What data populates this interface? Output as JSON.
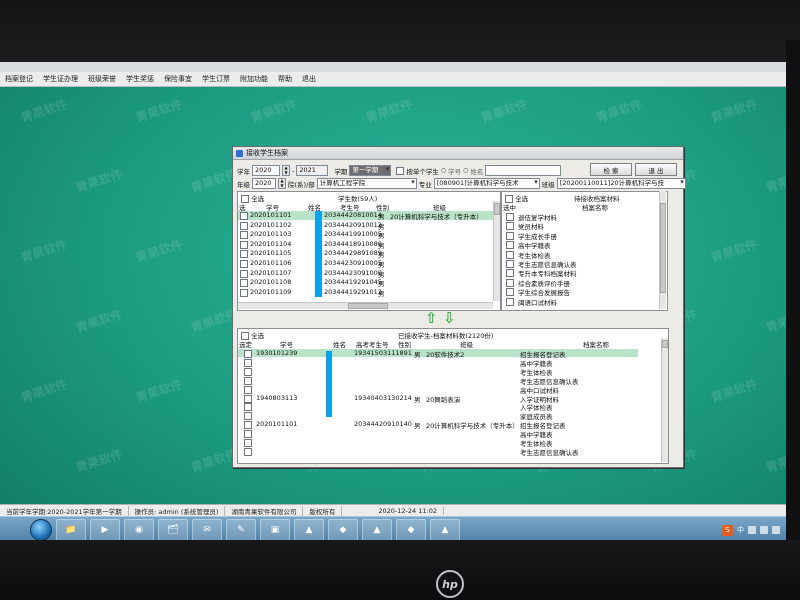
{
  "window": {
    "title": "接收学生档案"
  },
  "menubar": [
    "档案登记",
    "学生证办理",
    "班级荣誉",
    "学生奖惩",
    "保险事宜",
    "学生订票",
    "附加功能",
    "帮助",
    "退出"
  ],
  "watermark": {
    "text": "青果软件",
    "sub": "KINGOSOFT"
  },
  "filters": {
    "xuenian_label": "学年",
    "year_from": "2020",
    "dash": "-",
    "year_to": "2021",
    "xueqi_label": "学期",
    "xueqi_value": "第一学期",
    "single_student_label": "按单个学生",
    "radio_xuehao": "学号",
    "radio_xingming": "姓名",
    "search_button": "检 索",
    "close_button": "退 出",
    "nianji_label": "年级",
    "nianji_value": "2020",
    "yuanxi_label": "院(系)/部",
    "yuanxi_value": "计算机工程学院",
    "zhuanye_label": "专业",
    "zhuanye_value": "[080901]计算机科学与技术",
    "banji_label": "班级",
    "banji_value": "[20200110011]20计算机科学与技"
  },
  "students_panel": {
    "select_all": "全选",
    "select_col": "选",
    "title": "学生数(59人)",
    "columns": [
      "学号",
      "姓名",
      "考生号",
      "性别",
      "班级"
    ],
    "rows": [
      {
        "xuehao": "2020101101",
        "kaosheng": "20344420810014",
        "xingbie": "男",
        "banji": "20计算机科学与技术（专升本）",
        "selected": true
      },
      {
        "xuehao": "2020101102",
        "kaosheng": "20344420910012",
        "xingbie": "男",
        "banji": "",
        "selected": false
      },
      {
        "xuehao": "2020101103",
        "kaosheng": "20344419910005",
        "xingbie": "男",
        "banji": "",
        "selected": false
      },
      {
        "xuehao": "2020101104",
        "kaosheng": "20344418910080",
        "xingbie": "男",
        "banji": "",
        "selected": false
      },
      {
        "xuehao": "2020101105",
        "kaosheng": "20344429891089",
        "xingbie": "男",
        "banji": "",
        "selected": false
      },
      {
        "xuehao": "2020101106",
        "kaosheng": "20344230910005",
        "xingbie": "男",
        "banji": "",
        "selected": false
      },
      {
        "xuehao": "2020101107",
        "kaosheng": "20344423091000",
        "xingbie": "男",
        "banji": "",
        "selected": false
      },
      {
        "xuehao": "2020101108",
        "kaosheng": "20344419291045",
        "xingbie": "男",
        "banji": "",
        "selected": false
      },
      {
        "xuehao": "2020101109",
        "kaosheng": "20344419291013",
        "xingbie": "男",
        "banji": "",
        "selected": false
      }
    ]
  },
  "materials_panel": {
    "select_all": "全选",
    "title": "待接收档案材料",
    "select_col": "选中",
    "name_col": "档案名称",
    "items": [
      "退伍复学材料",
      "党员材料",
      "学生成长手册",
      "高中学籍表",
      "考生体检表",
      "考生志愿信息确认表",
      "专升本专科档案材料",
      "综合素质评价手册",
      "学生综合发展报告",
      "闽语口试材料"
    ]
  },
  "received_panel": {
    "select_all": "全选",
    "title": "已接收学生-档案材料数(2120份)",
    "columns": [
      "选定",
      "学号",
      "姓名",
      "高考考生号",
      "性别",
      "班级",
      "档案名称"
    ],
    "rows": [
      {
        "xuehao": "1930101239",
        "kaosheng": "19341503111891",
        "xingbie": "男",
        "banji": "20软件技术2",
        "dangan": "招生报名登记表",
        "highlight": true
      },
      {
        "xuehao": "",
        "kaosheng": "",
        "xingbie": "",
        "banji": "",
        "dangan": "高中学籍表",
        "highlight": false
      },
      {
        "xuehao": "",
        "kaosheng": "",
        "xingbie": "",
        "banji": "",
        "dangan": "考生体检表",
        "highlight": false
      },
      {
        "xuehao": "",
        "kaosheng": "",
        "xingbie": "",
        "banji": "",
        "dangan": "考生志愿信息确认表",
        "highlight": false
      },
      {
        "xuehao": "",
        "kaosheng": "",
        "xingbie": "",
        "banji": "",
        "dangan": "高中口试材料",
        "highlight": false
      },
      {
        "xuehao": "1940803113",
        "kaosheng": "19340403130214",
        "xingbie": "男",
        "banji": "20舞蹈表演",
        "dangan": "入学证明材料",
        "highlight": false
      },
      {
        "xuehao": "",
        "kaosheng": "",
        "xingbie": "",
        "banji": "",
        "dangan": "入学体检表",
        "highlight": false
      },
      {
        "xuehao": "",
        "kaosheng": "",
        "xingbie": "",
        "banji": "",
        "dangan": "家庭成员表",
        "highlight": false
      },
      {
        "xuehao": "2020101101",
        "kaosheng": "20344420910140",
        "xingbie": "男",
        "banji": "20计算机科学与技术（专升本）",
        "dangan": "招生报名登记表",
        "highlight": false
      },
      {
        "xuehao": "",
        "kaosheng": "",
        "xingbie": "",
        "banji": "",
        "dangan": "高中学籍表",
        "highlight": false
      },
      {
        "xuehao": "",
        "kaosheng": "",
        "xingbie": "",
        "banji": "",
        "dangan": "考生体检表",
        "highlight": false
      },
      {
        "xuehao": "",
        "kaosheng": "",
        "xingbie": "",
        "banji": "",
        "dangan": "考生志愿信息确认表",
        "highlight": false
      }
    ]
  },
  "statusbar": {
    "term": "当前学年学期:2020-2021学年第一学期",
    "operator": "操作员: admin (系统管理员)",
    "company": "湖南青果软件有限公司",
    "rights": "版权所有",
    "datetime": "2020-12-24 11:02"
  },
  "taskbar": {
    "apps": [
      "📁",
      "▶",
      "◉",
      "🗂",
      "✉",
      "✎",
      "▣",
      "▲",
      "◆",
      "▲",
      "◆",
      "▲"
    ],
    "ime": "S",
    "ime_mode": "中"
  },
  "colors": {
    "desktop": "#1b9a7f",
    "selection": "#b9e3c8",
    "redaction": "#0aa2e8",
    "arrow": "#3fb34f"
  }
}
